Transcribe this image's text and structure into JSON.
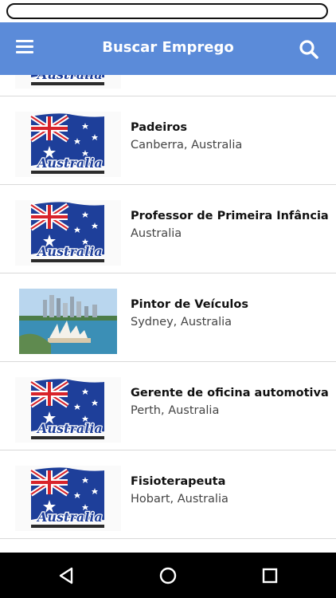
{
  "app_bar": {
    "title": "Buscar Emprego",
    "color": "#5b8bd9",
    "menu_icon": "menu-icon",
    "search_icon": "search-icon"
  },
  "flag_caption": "Australia",
  "jobs": [
    {
      "title": "",
      "location": "",
      "image": "australia-flag"
    },
    {
      "title": "Padeiros",
      "location": "Canberra, Australia",
      "image": "australia-flag"
    },
    {
      "title": "Professor de Primeira Infância",
      "location": "Australia",
      "image": "australia-flag"
    },
    {
      "title": "Pintor de Veículos",
      "location": "Sydney, Australia",
      "image": "sydney-opera-house-photo"
    },
    {
      "title": "Gerente de oficina automotiva",
      "location": "Perth, Australia",
      "image": "australia-flag"
    },
    {
      "title": "Fisioterapeuta",
      "location": "Hobart, Australia",
      "image": "australia-flag"
    },
    {
      "title": "",
      "location": "",
      "image": ""
    }
  ],
  "nav_bar": {
    "back_icon": "back-icon",
    "home_icon": "home-icon",
    "recents_icon": "recents-icon"
  }
}
